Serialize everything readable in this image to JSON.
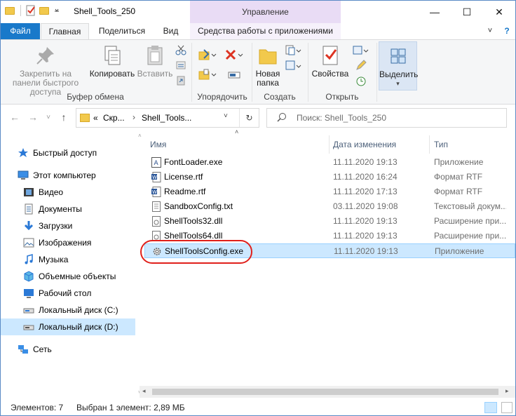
{
  "window": {
    "title": "Shell_Tools_250",
    "context_band": "Управление",
    "controls": {
      "minimize": "—",
      "maximize": "☐",
      "close": "✕"
    }
  },
  "tabs": [
    "Файл",
    "Главная",
    "Поделиться",
    "Вид",
    "Средства работы с приложениями"
  ],
  "ribbon": {
    "pin_label": "Закрепить на панели быстрого доступа",
    "copy_label": "Копировать",
    "paste_label": "Вставить",
    "clipboard_group": "Буфер обмена",
    "organize_group": "Упорядочить",
    "new_folder_label": "Новая папка",
    "create_group": "Создать",
    "properties_label": "Свойства",
    "open_group": "Открыть",
    "select_label": "Выделить"
  },
  "address": {
    "prefix": "«",
    "crumb1": "Скр...",
    "crumb2": "Shell_Tools...",
    "search_placeholder": "Поиск: Shell_Tools_250"
  },
  "nav": {
    "items": [
      {
        "label": "Быстрый доступ",
        "icon": "star-icon"
      },
      {
        "label": "Этот компьютер",
        "icon": "computer-icon"
      },
      {
        "label": "Видео",
        "icon": "video-icon"
      },
      {
        "label": "Документы",
        "icon": "documents-icon"
      },
      {
        "label": "Загрузки",
        "icon": "downloads-icon"
      },
      {
        "label": "Изображения",
        "icon": "images-icon"
      },
      {
        "label": "Музыка",
        "icon": "music-icon"
      },
      {
        "label": "Объемные объекты",
        "icon": "3d-objects-icon"
      },
      {
        "label": "Рабочий стол",
        "icon": "desktop-icon"
      },
      {
        "label": "Локальный диск (C:)",
        "icon": "drive-icon"
      },
      {
        "label": "Локальный диск (D:)",
        "icon": "drive-icon"
      },
      {
        "label": "Сеть",
        "icon": "network-icon"
      }
    ]
  },
  "columns": {
    "name": "Имя",
    "date": "Дата изменения",
    "type": "Тип"
  },
  "files": [
    {
      "name": "FontLoader.exe",
      "date": "11.11.2020 19:13",
      "type": "Приложение",
      "icon": "exe-icon"
    },
    {
      "name": "License.rtf",
      "date": "11.11.2020 16:24",
      "type": "Формат RTF",
      "icon": "rtf-icon"
    },
    {
      "name": "Readme.rtf",
      "date": "11.11.2020 17:13",
      "type": "Формат RTF",
      "icon": "rtf-icon"
    },
    {
      "name": "SandboxConfig.txt",
      "date": "03.11.2020 19:08",
      "type": "Текстовый докум...",
      "icon": "txt-icon"
    },
    {
      "name": "ShellTools32.dll",
      "date": "11.11.2020 19:13",
      "type": "Расширение при...",
      "icon": "dll-icon"
    },
    {
      "name": "ShellTools64.dll",
      "date": "11.11.2020 19:13",
      "type": "Расширение при...",
      "icon": "dll-icon"
    },
    {
      "name": "ShellToolsConfig.exe",
      "date": "11.11.2020 19:13",
      "type": "Приложение",
      "icon": "gear-icon"
    }
  ],
  "status": {
    "count": "Элементов: 7",
    "selection": "Выбран 1 элемент: 2,89 МБ"
  },
  "colors": {
    "accent": "#1979ca",
    "selection": "#cce8ff",
    "highlight_ring": "#e0201b",
    "context_band": "#e9dcf5"
  }
}
